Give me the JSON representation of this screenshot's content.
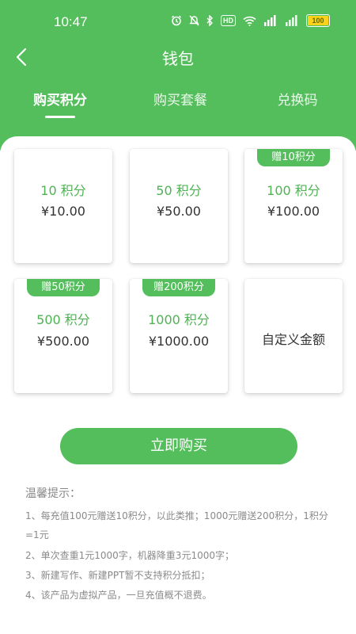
{
  "status_bar": {
    "time": "10:47",
    "icons": [
      "alarm-icon",
      "mute-icon",
      "bluetooth-icon",
      "hd-icon",
      "wifi-icon",
      "signal-5g-icon",
      "signal-4g-icon",
      "battery-icon"
    ],
    "hd_label": "HD",
    "battery_level": "100"
  },
  "header": {
    "title": "钱包",
    "back_icon": "chevron-left-icon"
  },
  "tabs": [
    {
      "label": "购买积分",
      "active": true
    },
    {
      "label": "购买套餐",
      "active": false
    },
    {
      "label": "兑换码",
      "active": false
    }
  ],
  "packages": [
    {
      "points": "10 积分",
      "price": "¥10.00",
      "badge": ""
    },
    {
      "points": "50 积分",
      "price": "¥50.00",
      "badge": ""
    },
    {
      "points": "100 积分",
      "price": "¥100.00",
      "badge": "赠10积分"
    },
    {
      "points": "500 积分",
      "price": "¥500.00",
      "badge": "赠50积分"
    },
    {
      "points": "1000 积分",
      "price": "¥1000.00",
      "badge": "赠200积分"
    }
  ],
  "custom_amount_label": "自定义金额",
  "buy_button_label": "立即购买",
  "tips": {
    "title": "温馨提示：",
    "items": [
      "1、每充值100元赠送10积分，以此类推；1000元赠送200积分，1积分=1元",
      "2、单次查重1元1000字，机器降重3元1000字；",
      "3、新建写作、新建PPT暂不支持积分抵扣；",
      "4、该产品为虚拟产品，一旦充值概不退费。"
    ]
  },
  "colors": {
    "primary": "#55be5c",
    "points_text": "#4db353"
  }
}
